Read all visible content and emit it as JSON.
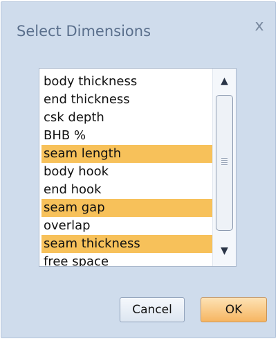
{
  "dialog": {
    "title": "Select Dimensions",
    "close_label": "x"
  },
  "list": {
    "items": [
      {
        "label": "body thickness",
        "selected": false
      },
      {
        "label": "end thickness",
        "selected": false
      },
      {
        "label": "csk depth",
        "selected": false
      },
      {
        "label": "BHB %",
        "selected": false
      },
      {
        "label": "seam length",
        "selected": true
      },
      {
        "label": "body hook",
        "selected": false
      },
      {
        "label": "end hook",
        "selected": false
      },
      {
        "label": "seam gap",
        "selected": true
      },
      {
        "label": "overlap",
        "selected": false
      },
      {
        "label": "seam thickness",
        "selected": true
      },
      {
        "label": "free space",
        "selected": false
      }
    ],
    "selection_color": "#f7c15a"
  },
  "buttons": {
    "cancel_label": "Cancel",
    "ok_label": "OK"
  }
}
